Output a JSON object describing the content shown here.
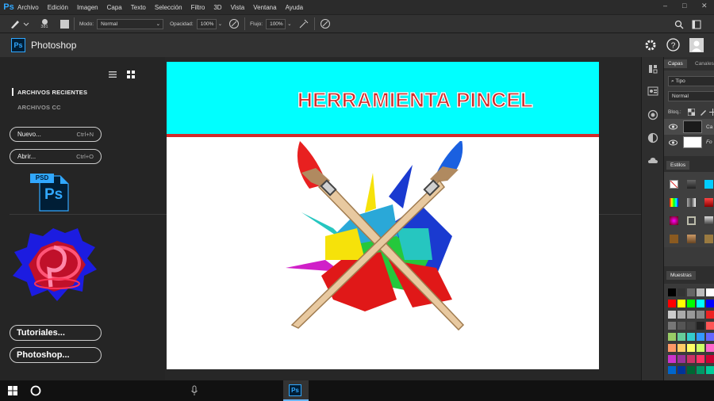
{
  "menubar": {
    "app_icon": "Ps",
    "items": [
      "Archivo",
      "Edición",
      "Imagen",
      "Capa",
      "Texto",
      "Selección",
      "Filtro",
      "3D",
      "Vista",
      "Ventana",
      "Ayuda"
    ]
  },
  "options": {
    "brush_size": "381",
    "mode_label": "Modo:",
    "mode_value": "Normal",
    "opacity_label": "Opacidad:",
    "opacity_value": "100%",
    "flow_label": "Flujo:",
    "flow_value": "100%"
  },
  "home": {
    "badge": "Ps",
    "title": "Photoshop"
  },
  "left": {
    "recent_label": "ARCHIVOS RECIENTES",
    "cc_label": "ARCHIVOS CC",
    "new_label": "Nuevo...",
    "new_shortcut": "Ctrl+N",
    "open_label": "Abrir...",
    "open_shortcut": "Ctrl+O",
    "psd_badge": "PSD",
    "psd_letters": "Ps",
    "tutorials_label": "Tutoriales...",
    "photoshop_label": "Photoshop..."
  },
  "canvas": {
    "banner_title": "HERRAMIENTA PINCEL",
    "banner_color": "#00ffff",
    "stripe_color": "#d42a2a"
  },
  "right": {
    "layers_tab": "Capas",
    "channels_tab": "Canales",
    "kind_filter": "Tipo",
    "blend_mode": "Normal",
    "lock_label": "Bloq.:",
    "layer1_name": "Ca",
    "layer2_name": "Fo",
    "styles_tab": "Estilos",
    "swatches_tab": "Muestras"
  },
  "accent": "#31a8ff"
}
